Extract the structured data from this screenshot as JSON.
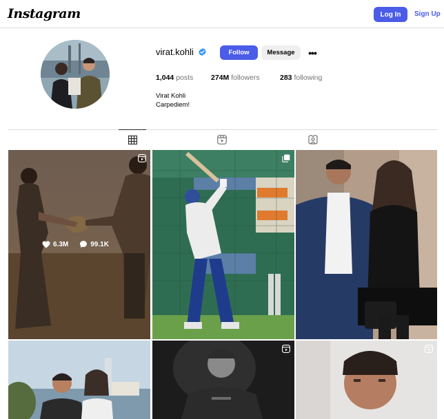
{
  "header": {
    "logo": "Instagram",
    "login_label": "Log In",
    "signup_label": "Sign Up"
  },
  "profile": {
    "username": "virat.kohli",
    "verified": true,
    "follow_label": "Follow",
    "message_label": "Message",
    "more_label": "•••",
    "stats": {
      "posts_count": "1,044",
      "posts_label": "posts",
      "followers_count": "274M",
      "followers_label": "followers",
      "following_count": "283",
      "following_label": "following"
    },
    "full_name": "Virat Kohli",
    "bio": "Carpediem!"
  },
  "tabs": [
    {
      "name": "posts",
      "icon": "grid-icon",
      "active": true
    },
    {
      "name": "reels",
      "icon": "reels-icon",
      "active": false
    },
    {
      "name": "tagged",
      "icon": "tagged-icon",
      "active": false
    }
  ],
  "posts": [
    {
      "type": "reel",
      "hovered": true,
      "likes": "6.3M",
      "comments": "99.1K"
    },
    {
      "type": "carousel"
    },
    {
      "type": "photo"
    },
    {
      "type": "photo"
    },
    {
      "type": "reel"
    },
    {
      "type": "reel"
    }
  ],
  "colors": {
    "accent": "#4a5ce8",
    "verified": "#3897f0",
    "border": "#dbdbdb"
  }
}
